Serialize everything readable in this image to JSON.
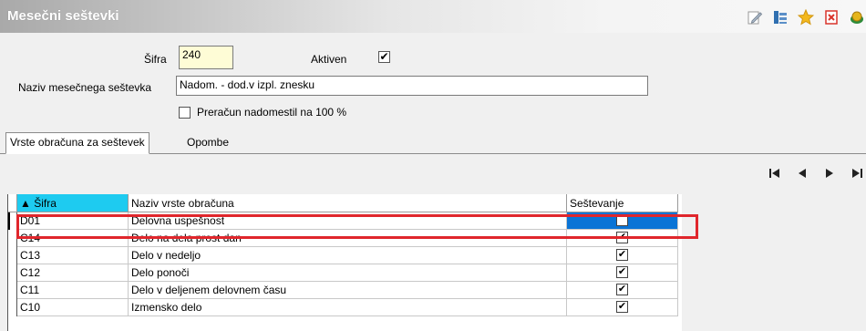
{
  "window": {
    "title": "Mesečni seštevki"
  },
  "toolbar": {
    "icons": [
      "edit-icon",
      "properties-icon",
      "favorite-star-icon",
      "close-document-icon",
      "money-icon"
    ],
    "star_color": "#f3b81e",
    "close_color": "#d9342b"
  },
  "form": {
    "sifra_label": "Šifra",
    "sifra_value": "240",
    "aktiven_label": "Aktiven",
    "aktiven_checked": "✔",
    "naziv_label": "Naziv mesečnega seštevka",
    "naziv_value": "Nadom. - dod.v izpl. znesku",
    "preracun_label": "Preračun nadomestil na 100 %",
    "preracun_checked": ""
  },
  "tabs": [
    {
      "label": "Vrste obračuna za seštevek",
      "active": true
    },
    {
      "label": "Opombe",
      "active": false
    }
  ],
  "nav": [
    "first-record-icon",
    "previous-record-icon",
    "next-record-icon",
    "last-record-icon"
  ],
  "grid": {
    "headers": {
      "sifra": "▲ Šifra",
      "naziv": "Naziv vrste obračuna",
      "sestevanje": "Seštevanje"
    },
    "sort_color": "#1ecbf0",
    "selected_color": "#0a74d6",
    "highlight_color": "#e0262c",
    "rows": [
      {
        "sifra": "D01",
        "naziv": "Delovna uspešnost",
        "check": ""
      },
      {
        "sifra": "C14",
        "naziv": "Delo na dela prost dan",
        "check": "✔"
      },
      {
        "sifra": "C13",
        "naziv": "Delo v nedeljo",
        "check": "✔"
      },
      {
        "sifra": "C12",
        "naziv": "Delo ponoči",
        "check": "✔"
      },
      {
        "sifra": "C11",
        "naziv": "Delo v deljenem delovnem času",
        "check": "✔"
      },
      {
        "sifra": "C10",
        "naziv": "Izmensko delo",
        "check": "✔"
      }
    ]
  }
}
